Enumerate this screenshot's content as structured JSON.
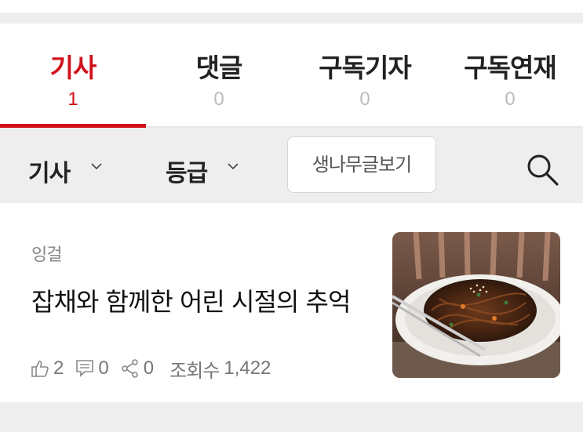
{
  "tabs": [
    {
      "label": "기사",
      "count": "1",
      "active": true
    },
    {
      "label": "댓글",
      "count": "0",
      "active": false
    },
    {
      "label": "구독기자",
      "count": "0",
      "active": false
    },
    {
      "label": "구독연재",
      "count": "0",
      "active": false
    }
  ],
  "filters": {
    "type_label": "기사",
    "grade_label": "등급",
    "raw_button_label": "생나무글보기",
    "search_icon": "search-icon"
  },
  "article": {
    "category": "잉걸",
    "title": "잡채와 함께한 어린 시절의 추억",
    "likes": "2",
    "comments": "0",
    "shares": "0",
    "views_label": "조회수",
    "views": "1,422",
    "thumbnail": "japchae-dish-photo"
  },
  "colors": {
    "accent": "#d0111b",
    "band": "#eeeeee",
    "muted": "#bbbbbb"
  }
}
